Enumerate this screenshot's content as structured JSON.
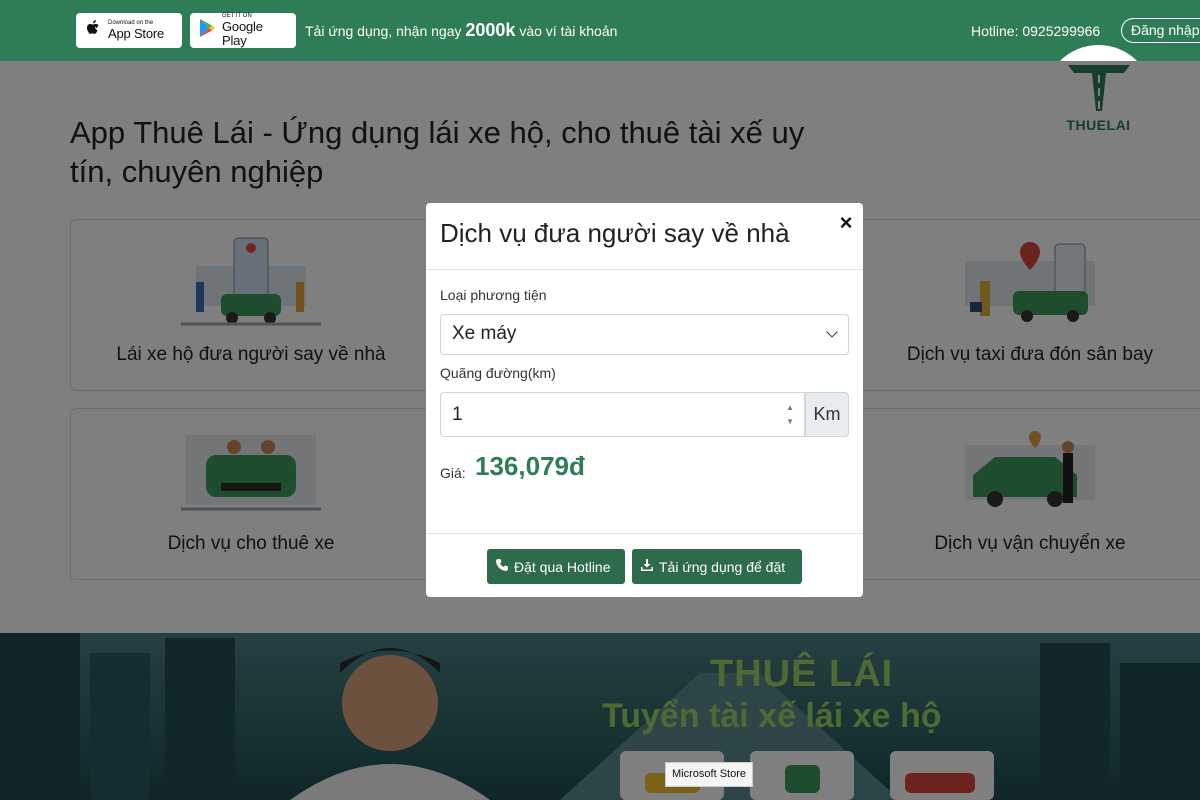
{
  "topbar": {
    "appstore": {
      "small": "Download on the",
      "large": "App Store"
    },
    "googleplay": {
      "small": "GET IT ON",
      "large": "Google Play"
    },
    "promo_prefix": "Tải ứng dụng, nhận ngay",
    "promo_amount": "2000k",
    "promo_suffix": "vào ví tài khoản",
    "hotline": "Hotline: 0925299966",
    "login": "Đăng nhập"
  },
  "logo": {
    "text": "THUELAI"
  },
  "page": {
    "title": "App Thuê Lái - Ứng dụng lái xe hộ, cho thuê tài xế uy tín, chuyên nghiệp",
    "cards": [
      {
        "label": "Lái xe hộ đưa người say về nhà"
      },
      {
        "label": "Dịch vụ taxi đưa đón sân bay"
      },
      {
        "label": "Dịch vụ cho thuê xe"
      },
      {
        "label": "Dịch vụ vận chuyển xe"
      }
    ]
  },
  "banner": {
    "line1": "THUÊ LÁI",
    "line2": "Tuyển tài xế lái xe hộ"
  },
  "modal": {
    "title": "Dịch vụ đưa người say về nhà",
    "close": "×",
    "vehicle_label": "Loại phương tiện",
    "vehicle_value": "Xe máy",
    "distance_label": "Quãng đường(km)",
    "distance_value": "1",
    "distance_unit": "Km",
    "price_label": "Giá:",
    "price_value": "136,079đ",
    "btn_hotline": "Đặt qua Hotline",
    "btn_app": "Tải ứng dụng để đặt"
  },
  "tooltip": {
    "text": "Microsoft Store"
  },
  "colors": {
    "brand_green": "#2e7d57",
    "button_green": "#2e6b4d"
  }
}
